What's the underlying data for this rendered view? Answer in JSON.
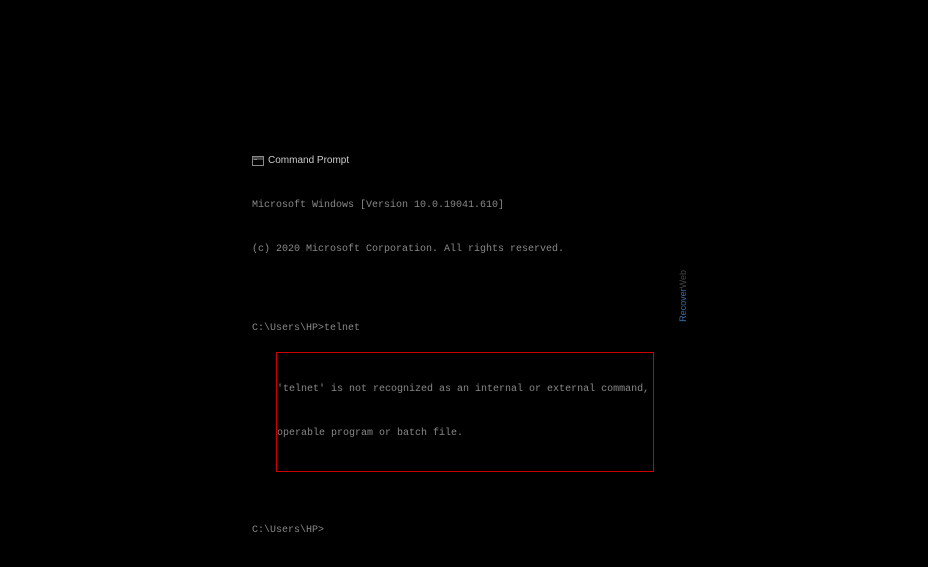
{
  "title_bar": {
    "icon_name": "cmd-icon",
    "title": "Command Prompt"
  },
  "terminal": {
    "version_line": "Microsoft Windows [Version 10.0.19041.610]",
    "copyright_line": "(c) 2020 Microsoft Corporation. All rights reserved.",
    "prompt1_path": "C:\\Users\\HP>",
    "prompt1_command": "telnet",
    "error_line1": "'telnet' is not recognized as an internal or external command,",
    "error_line2": "operable program or batch file.",
    "prompt2_path": "C:\\Users\\HP>"
  },
  "watermark": {
    "part1": "Recover",
    "part2": "Web"
  }
}
